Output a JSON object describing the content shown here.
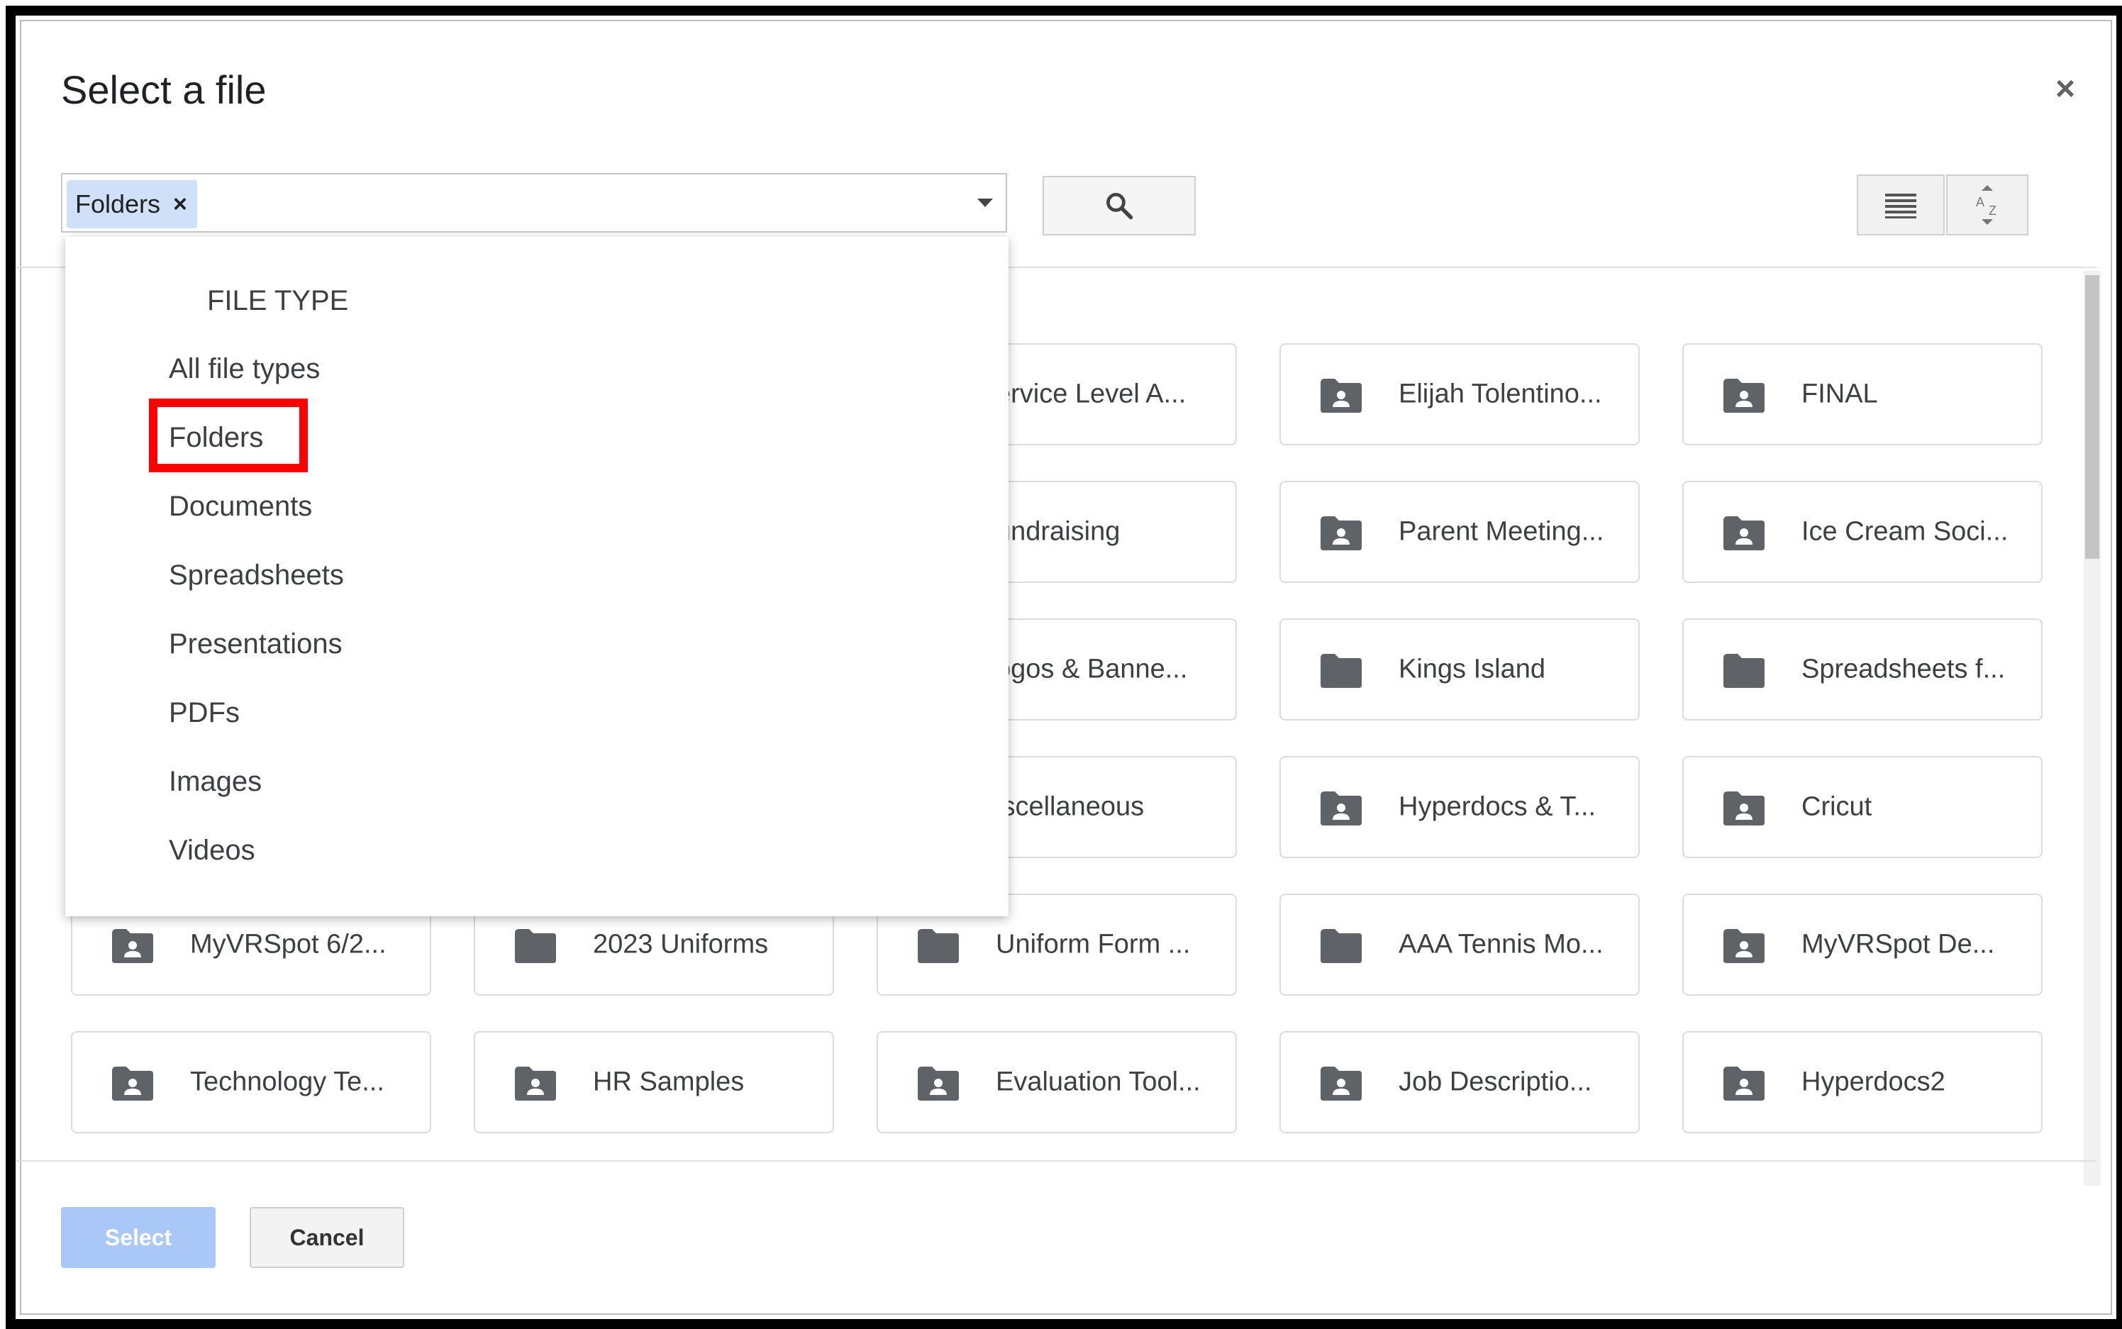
{
  "dialog": {
    "title": "Select a file",
    "close_label": "×"
  },
  "filter": {
    "chip_label": "Folders",
    "chip_remove": "×"
  },
  "dropdown": {
    "heading": "FILE TYPE",
    "items": [
      "All file types",
      "Folders",
      "Documents",
      "Spreadsheets",
      "Presentations",
      "PDFs",
      "Images",
      "Videos"
    ],
    "highlighted": "Folders"
  },
  "grid": {
    "items": [
      {
        "label": "ervice Level A...",
        "icon": "shared-folder-icon"
      },
      {
        "label": "Elijah Tolentino...",
        "icon": "shared-folder-icon"
      },
      {
        "label": "FINAL",
        "icon": "shared-folder-icon"
      },
      {
        "label": "undraising",
        "icon": "shared-folder-icon"
      },
      {
        "label": "Parent Meeting...",
        "icon": "shared-folder-icon"
      },
      {
        "label": "Ice Cream Soci...",
        "icon": "shared-folder-icon"
      },
      {
        "label": "ogos & Banne...",
        "icon": "folder-icon"
      },
      {
        "label": "Kings Island",
        "icon": "folder-icon"
      },
      {
        "label": "Spreadsheets f...",
        "icon": "folder-icon"
      },
      {
        "label": "iscellaneous",
        "icon": "shared-folder-icon"
      },
      {
        "label": "Hyperdocs & T...",
        "icon": "shared-folder-icon"
      },
      {
        "label": "Cricut",
        "icon": "shared-folder-icon"
      },
      {
        "label": "MyVRSpot 6/2...",
        "icon": "shared-folder-icon"
      },
      {
        "label": "2023 Uniforms",
        "icon": "folder-icon"
      },
      {
        "label": "Uniform Form ...",
        "icon": "folder-icon"
      },
      {
        "label": "AAA Tennis Mo...",
        "icon": "folder-icon"
      },
      {
        "label": "MyVRSpot De...",
        "icon": "shared-folder-icon"
      },
      {
        "label": "Technology Te...",
        "icon": "shared-folder-icon"
      },
      {
        "label": "HR Samples",
        "icon": "shared-folder-icon"
      },
      {
        "label": "Evaluation Tool...",
        "icon": "shared-folder-icon"
      },
      {
        "label": "Job Descriptio...",
        "icon": "shared-folder-icon"
      },
      {
        "label": "Hyperdocs2",
        "icon": "shared-folder-icon"
      }
    ]
  },
  "footer": {
    "select_label": "Select",
    "cancel_label": "Cancel"
  },
  "colors": {
    "chip_bg": "#cfe0f8",
    "select_bg": "#a9c7f7",
    "highlight": "#ff0000",
    "icon": "#5f6368"
  }
}
